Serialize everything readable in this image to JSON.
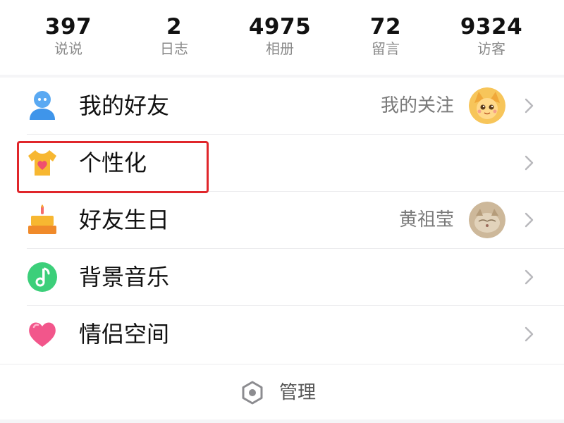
{
  "stats": [
    {
      "value": "397",
      "label": "说说"
    },
    {
      "value": "2",
      "label": "日志"
    },
    {
      "value": "4975",
      "label": "相册"
    },
    {
      "value": "72",
      "label": "留言"
    },
    {
      "value": "9324",
      "label": "访客"
    }
  ],
  "menu": {
    "items": [
      {
        "label": "我的好友",
        "extra": "我的关注",
        "icon": "friend-person-icon"
      },
      {
        "label": "个性化",
        "extra": "",
        "icon": "tshirt-heart-icon"
      },
      {
        "label": "好友生日",
        "extra": "黄祖莹",
        "icon": "birthday-cake-icon"
      },
      {
        "label": "背景音乐",
        "extra": "",
        "icon": "music-note-icon"
      },
      {
        "label": "情侣空间",
        "extra": "",
        "icon": "heart-icon"
      }
    ]
  },
  "footer": {
    "manage_label": "管理",
    "manage_icon": "hexagon-settings-icon"
  },
  "colors": {
    "highlight": "#e0262b",
    "stat_label": "#8a8a8a",
    "secondary_text": "#7a7a7a"
  }
}
